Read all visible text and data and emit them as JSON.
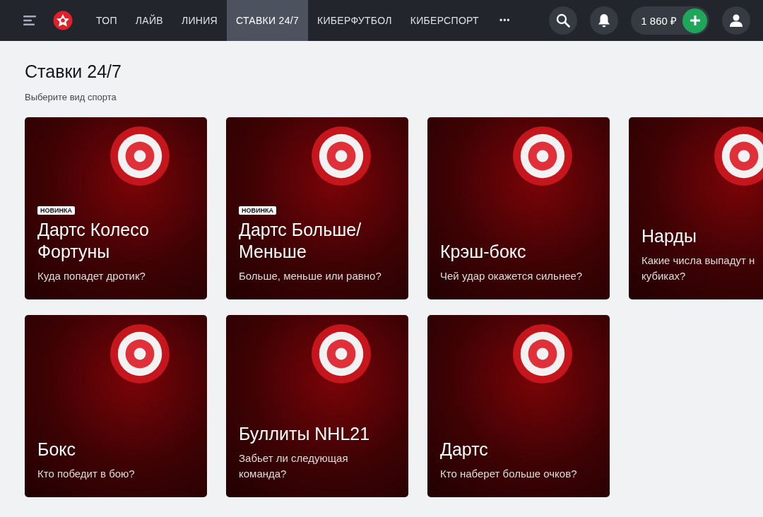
{
  "header": {
    "nav": [
      {
        "label": "ТОП",
        "selected": false
      },
      {
        "label": "ЛАЙВ",
        "selected": false
      },
      {
        "label": "ЛИНИЯ",
        "selected": false
      },
      {
        "label": "СТАВКИ 24/7",
        "selected": true
      },
      {
        "label": "КИБЕРФУТБОЛ",
        "selected": false
      },
      {
        "label": "КИБЕРСПОРТ",
        "selected": false
      }
    ],
    "more": "•••",
    "balance": "1 860 ₽"
  },
  "page": {
    "title": "Ставки 24/7",
    "subtitle": "Выберите вид спорта"
  },
  "cards": [
    {
      "badge": "НОВИНКА",
      "title": [
        "Дартс Колесо",
        "Фортуны"
      ],
      "description": [
        "Куда попадет дротик?"
      ]
    },
    {
      "badge": "НОВИНКА",
      "title": [
        "Дартс Больше/",
        "Меньше"
      ],
      "description": [
        "Больше, меньше или равно?"
      ]
    },
    {
      "title": [
        "Крэш-бокс"
      ],
      "description": [
        "Чей удар окажется сильнее?"
      ]
    },
    {
      "title": [
        "Нарды"
      ],
      "description": [
        "Какие числа выпадут н",
        "кубиках?"
      ]
    },
    {
      "title": [
        "Бокс"
      ],
      "description": [
        "Кто победит в бою?"
      ]
    },
    {
      "title": [
        "Буллиты NHL21"
      ],
      "description": [
        "Забьет ли следующая",
        "команда?"
      ]
    },
    {
      "title": [
        "Дартс"
      ],
      "description": [
        "Кто наберет больше очков?"
      ]
    }
  ]
}
